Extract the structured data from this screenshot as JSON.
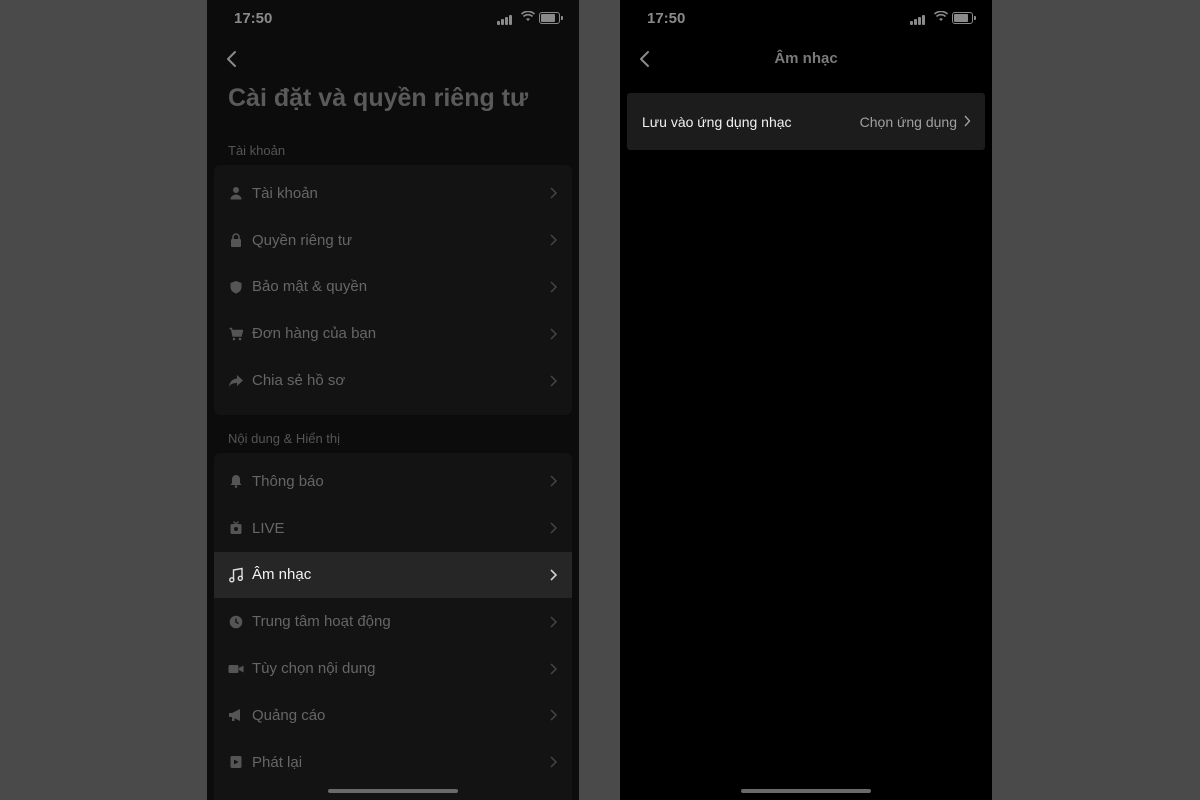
{
  "left_screen": {
    "time": "17:50",
    "title": "Cài đặt và quyền riêng tư",
    "sections": [
      {
        "label": "Tài khoản",
        "items": [
          {
            "label": "Tài khoản",
            "icon": "person-icon"
          },
          {
            "label": "Quyền riêng tư",
            "icon": "lock-icon"
          },
          {
            "label": "Bảo mật & quyền",
            "icon": "shield-icon"
          },
          {
            "label": "Đơn hàng của bạn",
            "icon": "cart-icon"
          },
          {
            "label": "Chia sẻ hồ sơ",
            "icon": "share-icon"
          }
        ]
      },
      {
        "label": "Nội dung & Hiển thị",
        "items": [
          {
            "label": "Thông báo",
            "icon": "bell-icon"
          },
          {
            "label": "LIVE",
            "icon": "live-icon"
          },
          {
            "label": "Âm nhạc",
            "icon": "music-note-icon",
            "selected": true
          },
          {
            "label": "Trung tâm hoạt động",
            "icon": "clock-icon"
          },
          {
            "label": "Tùy chọn nội dung",
            "icon": "video-icon"
          },
          {
            "label": "Quảng cáo",
            "icon": "megaphone-icon"
          },
          {
            "label": "Phát lại",
            "icon": "play-icon"
          }
        ]
      }
    ]
  },
  "right_screen": {
    "time": "17:50",
    "title": "Âm nhạc",
    "setting": {
      "label": "Lưu vào ứng dụng nhạc",
      "value": "Chọn ứng dụng"
    }
  },
  "colors": {
    "background": "#4a4a4a",
    "screen": "#000000",
    "selected_row": "#262626"
  }
}
